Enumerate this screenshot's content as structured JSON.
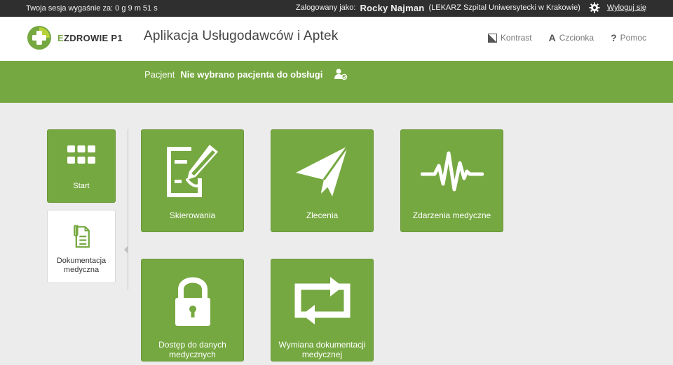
{
  "topbar": {
    "session_text": "Twoja sesja wygaśnie za: 0 g 9 m 51 s",
    "logged_as_label": "Zalogowany jako:",
    "user_name": "Rocky Najman",
    "user_role": "(LEKARZ Szpital Uniwersytecki w Krakowie)",
    "settings_icon": "gear-icon",
    "logout_label": "Wyloguj się"
  },
  "header": {
    "logo_text_e": "E",
    "logo_text_rest": "ZDROWIE P1",
    "app_title": "Aplikacja Usługodawców i Aptek",
    "tools": {
      "contrast": "Kontrast",
      "font": "Czcionka",
      "font_icon": "A",
      "help": "Pomoc",
      "help_icon": "?"
    }
  },
  "patient": {
    "label": "Pacjent",
    "value": "Nie wybrano pacjenta do obsługi",
    "icon": "select-patient-icon"
  },
  "sidenav": {
    "items": [
      {
        "label": "Start",
        "icon": "grid-icon",
        "active": true
      },
      {
        "label": "Dokumentacja medyczna",
        "icon": "medical-document-icon",
        "active": false
      }
    ]
  },
  "tiles": [
    {
      "label": "Skierowania",
      "icon": "referral-pen-icon"
    },
    {
      "label": "Zlecenia",
      "icon": "paper-plane-icon"
    },
    {
      "label": "Zdarzenia medyczne",
      "icon": "heartbeat-icon"
    },
    {
      "label": "Dostęp do danych medycznych",
      "icon": "padlock-icon"
    },
    {
      "label": "Wymiana dokumentacji medycznej",
      "icon": "exchange-arrows-icon"
    }
  ],
  "colors": {
    "brand_green": "#76a841",
    "topbar_dark": "#2f2f2f",
    "background": "#ececec"
  }
}
